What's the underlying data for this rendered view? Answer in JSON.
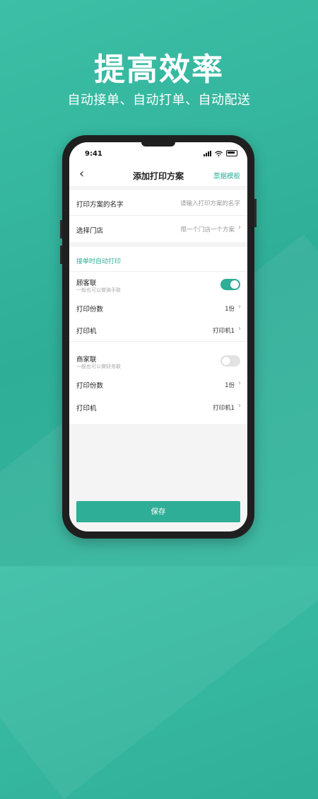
{
  "headline": "提高效率",
  "subline": "自动接单、自动打单、自动配送",
  "status": {
    "time": "9:41"
  },
  "nav": {
    "back_icon": "chevron-left-icon",
    "title": "添加打印方案",
    "right_link": "票据模板"
  },
  "form": {
    "name_label": "打印方案的名字",
    "name_placeholder": "请输入打印方案的名字",
    "store_label": "选择门店",
    "store_value": "限一个门店一个方案"
  },
  "auto_print": {
    "title": "接单时自动打印",
    "customer": {
      "label": "顾客联",
      "desc": "一般也可以做骑手联",
      "enabled": true,
      "copies_label": "打印份数",
      "copies_value": "1份",
      "printer_label": "打印机",
      "printer_value": "打印机1"
    },
    "merchant": {
      "label": "商家联",
      "desc": "一般也可以做财务联",
      "enabled": false,
      "copies_label": "打印份数",
      "copies_value": "1份",
      "printer_label": "打印机",
      "printer_value": "打印机1"
    }
  },
  "save_label": "保存",
  "colors": {
    "accent": "#2fae97",
    "background": "#3cbfa6"
  }
}
